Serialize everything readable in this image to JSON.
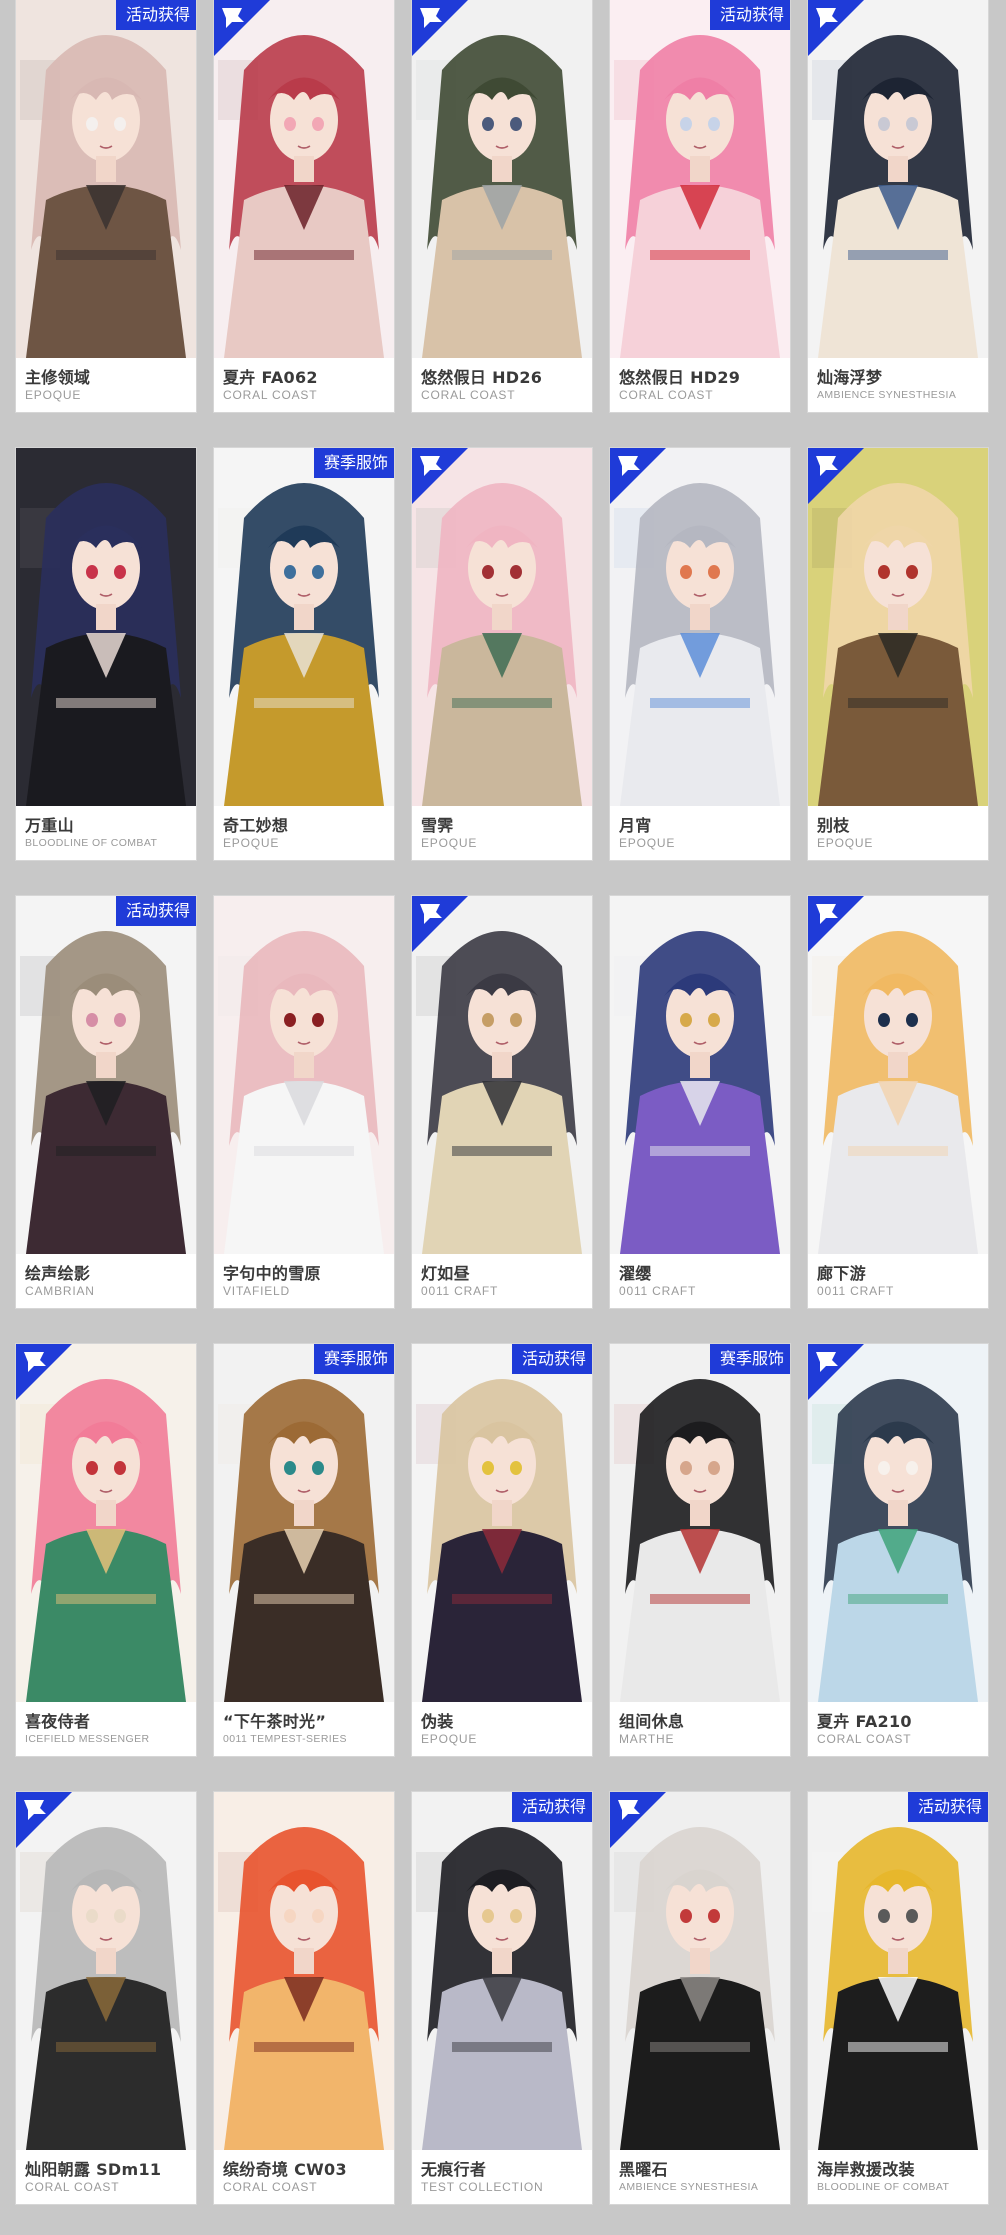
{
  "colors": {
    "badge_blue": "#1f3bd8",
    "background": "#c8c8c8",
    "card": "#ffffff",
    "name_text": "#3a3a3a",
    "brand_text": "#9a9a9a"
  },
  "skins": [
    {
      "name": "主修领域",
      "brand": "EPOQUE",
      "badge": "活动获得",
      "badge_type": "text",
      "palette": [
        "#efe4df",
        "#d8b8b3",
        "#6e5544",
        "#f4f0ee",
        "#3a3230"
      ]
    },
    {
      "name": "夏卉 FA062",
      "brand": "CORAL COAST",
      "badge": "corner",
      "badge_type": "corner",
      "palette": [
        "#f7eef0",
        "#b93b4a",
        "#e8c9c4",
        "#f2a7b5",
        "#6a2028"
      ]
    },
    {
      "name": "悠然假日 HD26",
      "brand": "CORAL COAST",
      "badge": "corner",
      "badge_type": "corner",
      "palette": [
        "#f1f1f1",
        "#3f4a34",
        "#d8c2a8",
        "#4b5a7c",
        "#9ea3a6"
      ]
    },
    {
      "name": "悠然假日 HD29",
      "brand": "CORAL COAST",
      "badge": "活动获得",
      "badge_type": "text",
      "palette": [
        "#fbeef2",
        "#ef7fa6",
        "#f6d1d9",
        "#c7d3e8",
        "#d12b3a"
      ]
    },
    {
      "name": "灿海浮梦",
      "brand": "AMBIENCE SYNESTHESIA",
      "badge": "corner",
      "badge_type": "corner",
      "palette": [
        "#f3f3f3",
        "#1d2433",
        "#efe4d6",
        "#c9c9d4",
        "#3c5a8c"
      ]
    },
    {
      "name": "万重山",
      "brand": "BLOODLINE OF COMBAT",
      "badge": "",
      "badge_type": "none",
      "palette": [
        "#2b2b33",
        "#2a2f5c",
        "#1a1a1f",
        "#c8334a",
        "#e9dbd5"
      ]
    },
    {
      "name": "奇工妙想",
      "brand": "EPOQUE",
      "badge": "赛季服饰",
      "badge_type": "text",
      "palette": [
        "#f5f5f5",
        "#1f3a58",
        "#c59a2c",
        "#3e6f9c",
        "#e8e2d6"
      ]
    },
    {
      "name": "雪霁",
      "brand": "EPOQUE",
      "badge": "corner",
      "badge_type": "corner",
      "palette": [
        "#f6e4e6",
        "#f0b5c2",
        "#cab79c",
        "#a23035",
        "#3f6d55"
      ]
    },
    {
      "name": "月宵",
      "brand": "EPOQUE",
      "badge": "corner",
      "badge_type": "corner",
      "palette": [
        "#f2f2f4",
        "#b5b7c1",
        "#e9eaee",
        "#e0784f",
        "#5d8ed8"
      ]
    },
    {
      "name": "别枝",
      "brand": "EPOQUE",
      "badge": "corner",
      "badge_type": "corner",
      "palette": [
        "#d9d27a",
        "#efd6a8",
        "#7a5a3a",
        "#b0342d",
        "#2c2a25"
      ]
    },
    {
      "name": "绘声绘影",
      "brand": "CAMBRIAN",
      "badge": "活动获得",
      "badge_type": "text",
      "palette": [
        "#f4f4f4",
        "#9b8d7a",
        "#3d2a33",
        "#d68ea6",
        "#1f1f22"
      ]
    },
    {
      "name": "字句中的雪原",
      "brand": "VITAFIELD",
      "badge": "",
      "badge_type": "none",
      "palette": [
        "#f7eeee",
        "#e9b8bd",
        "#f6f6f6",
        "#8a1f22",
        "#d9d9dd"
      ]
    },
    {
      "name": "灯如昼",
      "brand": "0011 CRAFT",
      "badge": "corner",
      "badge_type": "corner",
      "palette": [
        "#f2f2f2",
        "#3b3a44",
        "#e1d4b5",
        "#c69e66",
        "#2e2f35"
      ]
    },
    {
      "name": "濯缨",
      "brand": "0011 CRAFT",
      "badge": "",
      "badge_type": "none",
      "palette": [
        "#f4f4f4",
        "#2c3a7a",
        "#7b5cc4",
        "#d7a94a",
        "#e8e8ee"
      ]
    },
    {
      "name": "廊下游",
      "brand": "0011 CRAFT",
      "badge": "corner",
      "badge_type": "corner",
      "palette": [
        "#f6f6f6",
        "#f1b962",
        "#e9e9ec",
        "#1d2f4c",
        "#f2d3b0"
      ]
    },
    {
      "name": "喜夜侍者",
      "brand": "ICEFIELD MESSENGER",
      "badge": "corner",
      "badge_type": "corner",
      "palette": [
        "#f6f1ea",
        "#f27c98",
        "#3b8a66",
        "#c3343b",
        "#e6c07a"
      ]
    },
    {
      "name": "“下午茶时光”",
      "brand": "0011 TEMPEST-SERIES",
      "badge": "赛季服饰",
      "badge_type": "text",
      "palette": [
        "#f2f2f2",
        "#9c6a35",
        "#3a2d26",
        "#2b8a8a",
        "#e9d2b3"
      ]
    },
    {
      "name": "伪装",
      "brand": "EPOQUE",
      "badge": "活动获得",
      "badge_type": "text",
      "palette": [
        "#f4f4f4",
        "#d9c4a0",
        "#2a2438",
        "#e3c23e",
        "#8c2a3a"
      ]
    },
    {
      "name": "组间休息",
      "brand": "MARTHE",
      "badge": "赛季服饰",
      "badge_type": "text",
      "palette": [
        "#f1f1f1",
        "#1c1c1e",
        "#e9e9e9",
        "#d6a68c",
        "#b43232"
      ]
    },
    {
      "name": "夏卉 FA210",
      "brand": "CORAL COAST",
      "badge": "corner",
      "badge_type": "corner",
      "palette": [
        "#eef3f7",
        "#2c3a4c",
        "#bcd7e8",
        "#f7f1ec",
        "#3fa37a"
      ]
    },
    {
      "name": "灿阳朝露 SDm11",
      "brand": "CORAL COAST",
      "badge": "corner",
      "badge_type": "corner",
      "palette": [
        "#f3f3f3",
        "#b7b7b7",
        "#2c2c2c",
        "#eadbc9",
        "#8a6a3a"
      ]
    },
    {
      "name": "缤纷奇境 CW03",
      "brand": "CORAL COAST",
      "badge": "",
      "badge_type": "none",
      "palette": [
        "#f8eee6",
        "#e8532e",
        "#f2b56b",
        "#f6d6c2",
        "#7a2a1e"
      ]
    },
    {
      "name": "无痕行者",
      "brand": "TEST COLLECTION",
      "badge": "活动获得",
      "badge_type": "text",
      "palette": [
        "#f2f2f2",
        "#1d1d22",
        "#b9b9c8",
        "#e6c890",
        "#3a3a40"
      ]
    },
    {
      "name": "黑曜石",
      "brand": "AMBIENCE SYNESTHESIA",
      "badge": "corner",
      "badge_type": "corner",
      "palette": [
        "#efefef",
        "#d9d4cf",
        "#1c1c1c",
        "#c23a3a",
        "#8d8a86"
      ]
    },
    {
      "name": "海岸救援改装",
      "brand": "BLOODLINE OF COMBAT",
      "badge": "活动获得",
      "badge_type": "text",
      "palette": [
        "#f2f2f2",
        "#e7b72c",
        "#1d1d1d",
        "#5a5a5a",
        "#ffffff"
      ]
    }
  ]
}
